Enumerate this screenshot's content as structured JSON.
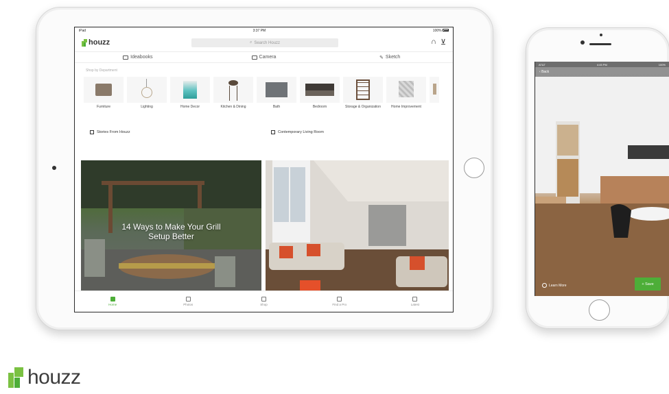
{
  "ipad": {
    "status": {
      "carrier": "iPad",
      "time": "3:37 PM",
      "battery": "100%"
    },
    "app_name": "houzz",
    "search": {
      "placeholder": "Search Houzz"
    },
    "subnav": [
      {
        "label": "Ideabooks",
        "icon": "ideabooks-icon"
      },
      {
        "label": "Camera",
        "icon": "camera-icon"
      },
      {
        "label": "Sketch",
        "icon": "sketch-icon"
      }
    ],
    "dept_heading": "Shop by Department",
    "departments": [
      {
        "label": "Furniture"
      },
      {
        "label": "Lighting"
      },
      {
        "label": "Home Decor"
      },
      {
        "label": "Kitchen & Dining"
      },
      {
        "label": "Bath"
      },
      {
        "label": "Bedroom"
      },
      {
        "label": "Storage & Organization"
      },
      {
        "label": "Home Improvement"
      }
    ],
    "sections": [
      {
        "label": "Stories From Houzz"
      },
      {
        "label": "Contemporary Living Room"
      }
    ],
    "story_title": "14 Ways to Make Your Grill Setup Better",
    "tabs": [
      {
        "label": "Home",
        "icon": "home-icon",
        "active": true
      },
      {
        "label": "Photos",
        "icon": "photos-icon",
        "active": false
      },
      {
        "label": "Shop",
        "icon": "shop-icon",
        "active": false
      },
      {
        "label": "Find a Pro",
        "icon": "find-a-pro-icon",
        "active": false
      },
      {
        "label": "Latest",
        "icon": "latest-icon",
        "active": false
      }
    ]
  },
  "iphone": {
    "status": {
      "carrier": "AT&T",
      "time": "4:45 PM",
      "battery": "100%"
    },
    "nav_back": "Back",
    "learn_more": "Learn More",
    "save_label": "+ Save"
  },
  "brand": {
    "name": "houzz"
  },
  "colors": {
    "accent_green": "#4dae38",
    "logo_green": "#7ac142"
  }
}
